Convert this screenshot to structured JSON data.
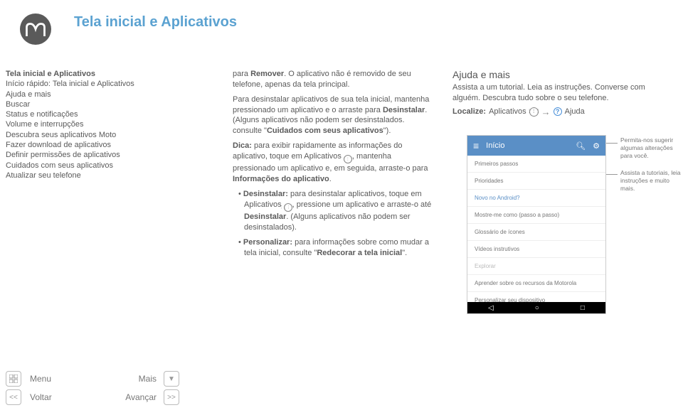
{
  "page_title": "Tela inicial e Aplicativos",
  "sidebar": {
    "heading": "Tela inicial e Aplicativos",
    "items": [
      "Início rápido: Tela inicial e Aplicativos",
      "Ajuda e mais",
      "Buscar",
      "Status e notificações",
      "Volume e interrupções",
      "Descubra seus aplicativos Moto",
      "Fazer download de aplicativos",
      "Definir permissões de aplicativos",
      "Cuidados com seus aplicativos",
      "Atualizar seu telefone"
    ]
  },
  "middle": {
    "p1_before": "para ",
    "p1_bold": "Remover",
    "p1_after": ". O aplicativo não é removido de seu telefone, apenas da tela principal.",
    "p2_a": "Para desinstalar aplicativos de sua tela inicial, mantenha pressionado um aplicativo e o arraste para ",
    "p2_b": "Desinstalar",
    "p2_c": ". (Alguns aplicativos não podem ser desinstalados. consulte \"",
    "p2_d": "Cuidados com seus aplicativos",
    "p2_e": "\").",
    "p3_a": "Dica:",
    "p3_b": " para exibir rapidamente as informações do aplicativo, toque em Aplicativos ",
    "p3_c": ", mantenha pressionado um aplicativo e, em seguida, arraste-o para ",
    "p3_d": "Informações do aplicativo",
    "p3_e": ".",
    "p4_a": "Desinstalar:",
    "p4_b": " para desinstalar aplicativos, toque em Aplicativos ",
    "p4_c": ", pressione um aplicativo e arraste-o até ",
    "p4_d": "Desinstalar",
    "p4_e": ". (Alguns aplicativos não podem ser desinstalados).",
    "p5_a": "Personalizar:",
    "p5_b": " para informações sobre como mudar a tela inicial, consulte \"",
    "p5_c": "Redecorar a tela inicial",
    "p5_d": "\"."
  },
  "right": {
    "heading": "Ajuda e mais",
    "line1": "Assista a um tutorial. Leia as instruções. Converse com alguém. Descubra tudo sobre o seu telefone.",
    "localize_label": "Localize:",
    "localize_app": "Aplicativos",
    "localize_ajuda": "Ajuda",
    "callout1": "Permita-nos sugerir algumas alterações para você.",
    "callout2": "Assista a tutoriais, leia instruções e muito mais."
  },
  "phone": {
    "title": "Início",
    "items": [
      "Primeiros passos",
      "Prioridades",
      "Novo no Android?",
      "Mostre-me como (passo a passo)",
      "Glossário de ícones",
      "Vídeos instrutivos",
      "Explorar",
      "Aprender sobre os recursos da Motorola",
      "Personalizar seu dispositivo"
    ]
  },
  "bottom": {
    "menu": "Menu",
    "mais": "Mais",
    "voltar": "Voltar",
    "avancar": "Avançar"
  }
}
